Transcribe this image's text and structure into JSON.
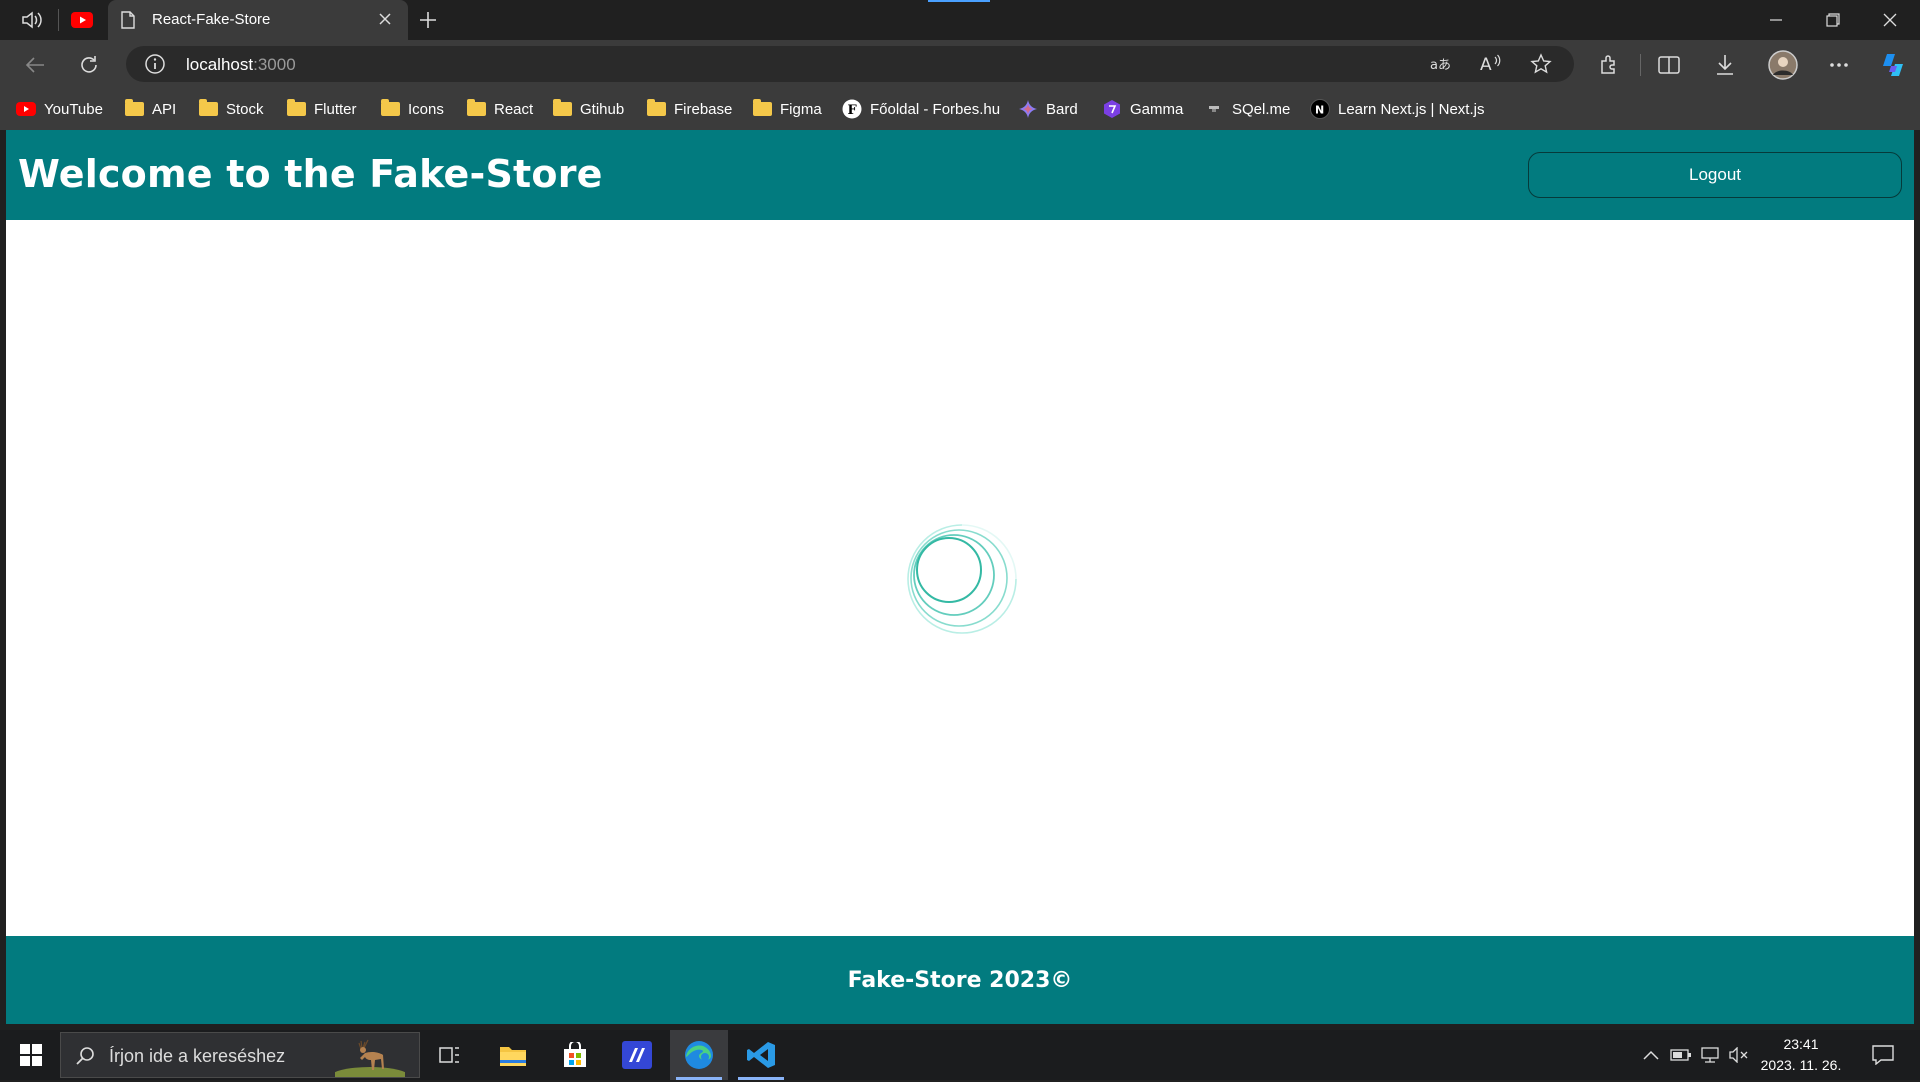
{
  "browser": {
    "tab": {
      "title": "React-Fake-Store"
    },
    "address": {
      "host": "localhost",
      "port": ":3000"
    },
    "bookmarks": [
      {
        "label": "YouTube",
        "icon": "youtube-icon"
      },
      {
        "label": "API",
        "icon": "folder-icon"
      },
      {
        "label": "Stock",
        "icon": "folder-icon"
      },
      {
        "label": "Flutter",
        "icon": "folder-icon"
      },
      {
        "label": "Icons",
        "icon": "folder-icon"
      },
      {
        "label": "React",
        "icon": "folder-icon"
      },
      {
        "label": "Gtihub",
        "icon": "folder-icon"
      },
      {
        "label": "Firebase",
        "icon": "folder-icon"
      },
      {
        "label": "Figma",
        "icon": "folder-icon"
      },
      {
        "label": "Főoldal - Forbes.hu",
        "icon": "forbes-icon"
      },
      {
        "label": "Bard",
        "icon": "bard-icon"
      },
      {
        "label": "Gamma",
        "icon": "gamma-icon"
      },
      {
        "label": "SQel.me",
        "icon": "sqel-icon"
      },
      {
        "label": "Learn Next.js | Next.js",
        "icon": "nextjs-icon"
      }
    ]
  },
  "app": {
    "header": {
      "title": "Welcome to the Fake-Store",
      "logout_label": "Logout"
    },
    "footer": {
      "text": "Fake-Store 2023©"
    },
    "colors": {
      "primary": "#027b7f",
      "spinner": "#5fd3bf"
    }
  },
  "taskbar": {
    "search_placeholder": "Írjon ide a kereséshez",
    "time": "23:41",
    "date": "2023. 11. 26."
  }
}
